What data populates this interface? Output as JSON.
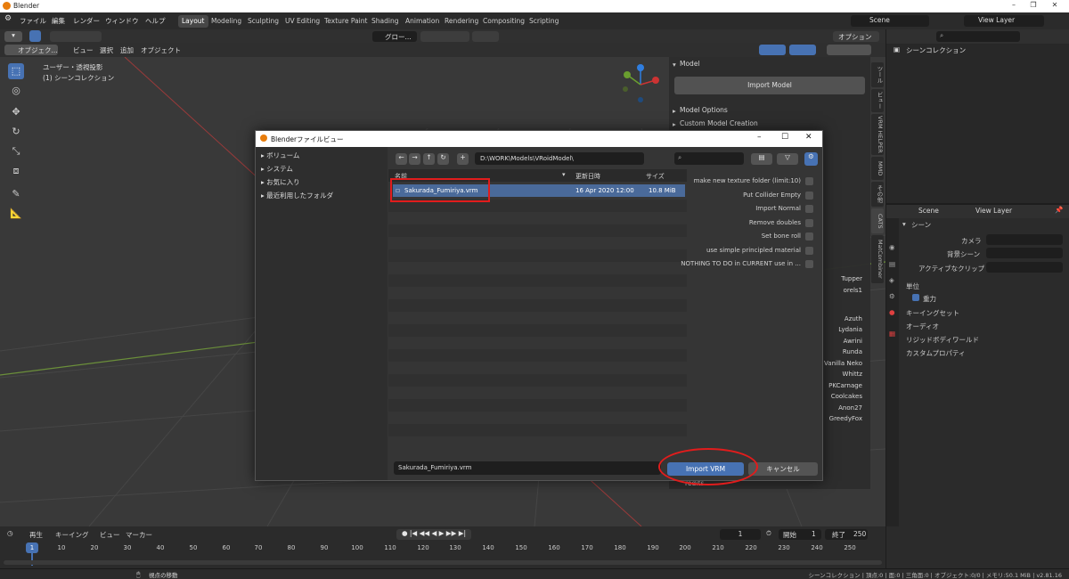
{
  "app": {
    "title": "Blender"
  },
  "menu": [
    "ファイル",
    "編集",
    "レンダー",
    "ウィンドウ",
    "ヘルプ"
  ],
  "workspaces": [
    "Layout",
    "Modeling",
    "Sculpting",
    "UV Editing",
    "Texture Paint",
    "Shading",
    "Animation",
    "Rendering",
    "Compositing",
    "Scripting"
  ],
  "scene": {
    "name": "Scene",
    "layer": "View Layer"
  },
  "vp_header": {
    "mode": "オブジェク...",
    "view": "ビュー",
    "select": "選択",
    "add": "追加",
    "object": "オブジェクト",
    "orientation": "グロー...",
    "options": "オプション"
  },
  "viewport": {
    "line1": "ユーザー・透視投影",
    "line2": "(1) シーンコレクション"
  },
  "npanel": {
    "section": "Model",
    "import_btn": "Import Model",
    "opt1": "Model Options",
    "opt2": "Custom Model Creation",
    "list": [
      "Tupper",
      "orels1",
      "Azuth",
      "Lydania",
      "Awrini",
      "Runda",
      "Vanilla Neko",
      "Whittz",
      "PKCarnage",
      "Coolcakes",
      "Anon27",
      "GreedyFox"
    ],
    "credits": "redits"
  },
  "vtabs": [
    "ツール",
    "ビュー",
    "VRM HELPER",
    "MMD",
    "その他",
    "CATS",
    "MatCombiner"
  ],
  "dialog": {
    "title": "Blenderファイルビュー",
    "sidebar": [
      "ボリューム",
      "システム",
      "お気に入り",
      "最近利用したフォルダ"
    ],
    "path": "D:\\WORK\\Models\\VRoidModel\\",
    "columns": {
      "name": "名前",
      "date": "更新日時",
      "size": "サイズ"
    },
    "files": [
      {
        "name": "Sakurada_Fumiriya.vrm",
        "date": "16 Apr 2020 12:00",
        "size": "10.8 MiB"
      }
    ],
    "options": [
      "make new texture folder (limit:10)",
      "Put Collider Empty",
      "Import Normal",
      "Remove doubles",
      "Set bone roll",
      "use simple principled material",
      "NOTHING TO DO in CURRENT use in ..."
    ],
    "filename": "Sakurada_Fumiriya.vrm",
    "import_btn": "Import VRM",
    "cancel_btn": "キャンセル"
  },
  "outliner": {
    "root": "シーンコレクション"
  },
  "properties": {
    "scene": "Scene",
    "layer": "View Layer",
    "section": "シーン",
    "camera": "カメラ",
    "bg_scene": "背景シーン",
    "active_clip": "アクティブなクリップ",
    "units": "単位",
    "gravity": "重力",
    "keying": "キーイングセット",
    "audio": "オーディオ",
    "rigid": "リジッドボディワールド",
    "custom": "カスタムプロパティ"
  },
  "timeline": {
    "play": "再生",
    "keying": "キーイング",
    "view": "ビュー",
    "marker": "マーカー",
    "current": "1",
    "start_label": "開始",
    "start": "1",
    "end_label": "終了",
    "end": "250",
    "ticks": [
      "1",
      "10",
      "20",
      "30",
      "40",
      "50",
      "60",
      "70",
      "80",
      "90",
      "100",
      "110",
      "120",
      "130",
      "140",
      "150",
      "160",
      "170",
      "180",
      "190",
      "200",
      "210",
      "220",
      "230",
      "240",
      "250"
    ]
  },
  "status": {
    "left": "視点の移動",
    "right": "シーンコレクション | 頂点:0 | 面:0 | 三角面:0 | オブジェクト:0/0 | メモリ:50.1 MiB | v2.81.16"
  },
  "colors": {
    "accent": "#4772b3",
    "highlight": "#e11c1c"
  }
}
